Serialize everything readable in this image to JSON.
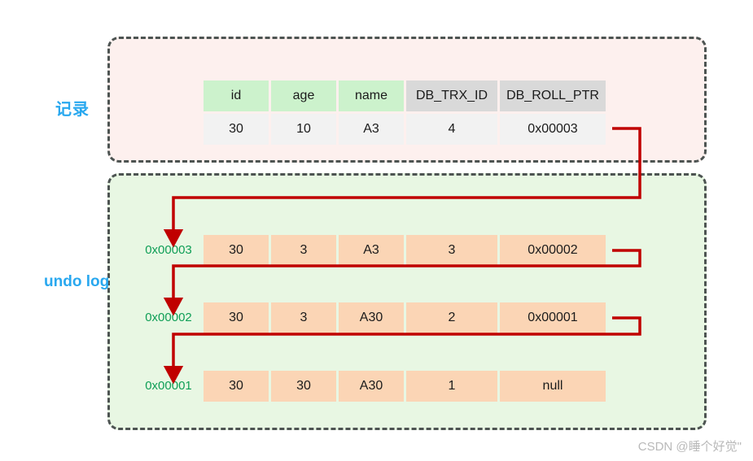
{
  "labels": {
    "record": "记录",
    "undo_log": "undo log"
  },
  "record_table": {
    "headers": [
      "id",
      "age",
      "name",
      "DB_TRX_ID",
      "DB_ROLL_PTR"
    ],
    "row": [
      "30",
      "10",
      "A3",
      "4",
      "0x00003"
    ]
  },
  "undo_log": {
    "entries": [
      {
        "ptr": "0x00003",
        "cells": [
          "30",
          "3",
          "A3",
          "3",
          "0x00002"
        ]
      },
      {
        "ptr": "0x00002",
        "cells": [
          "30",
          "3",
          "A30",
          "2",
          "0x00001"
        ]
      },
      {
        "ptr": "0x00001",
        "cells": [
          "30",
          "30",
          "A30",
          "1",
          "null"
        ]
      }
    ]
  },
  "colors": {
    "header_green": "#ccf2cc",
    "header_gray": "#d9d9d9",
    "value_gray": "#f2f2f2",
    "undo_peach": "#fbd5b5",
    "record_bg": "#fdf0ee",
    "undo_bg": "#e8f7e3",
    "border_dash": "#4d5452",
    "connector_red": "#c00000",
    "label_blue": "#29a8ef",
    "ptr_green": "#0e9e56"
  },
  "watermark": {
    "text": "CSDN @睡个好觉\""
  }
}
